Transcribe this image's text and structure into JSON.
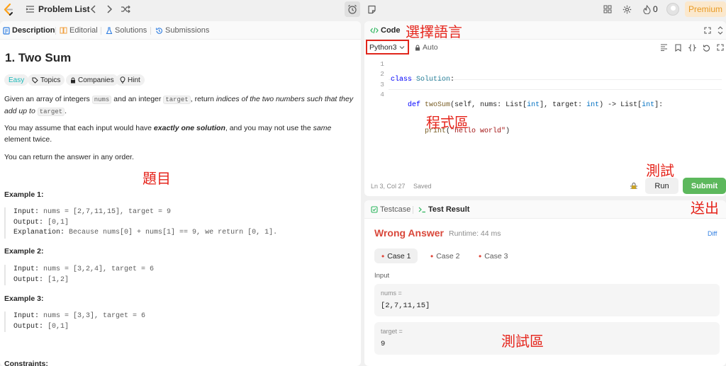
{
  "colors": {
    "accent_red": "#e5241b",
    "submit_green": "#5cb85c",
    "easy_teal": "#1cbaba",
    "premium_orange": "#e89b25",
    "wrong_answer": "#d9473a"
  },
  "topbar": {
    "problem_list": "Problem List",
    "streak_count": "0",
    "premium": "Premium",
    "icons": [
      "leetcode-logo",
      "list-icon",
      "chevron-left-icon",
      "chevron-right-icon",
      "shuffle-icon",
      "alarm-clock-icon",
      "note-icon",
      "layout-icon",
      "settings-icon",
      "flame-icon",
      "avatar"
    ]
  },
  "left_tabs": [
    {
      "label": "Description",
      "icon": "description-icon"
    },
    {
      "label": "Editorial",
      "icon": "editorial-icon"
    },
    {
      "label": "Solutions",
      "icon": "flask-icon"
    },
    {
      "label": "Submissions",
      "icon": "history-icon"
    }
  ],
  "problem": {
    "title": "1. Two Sum",
    "chips": {
      "difficulty": "Easy",
      "topics": "Topics",
      "companies": "Companies",
      "hint": "Hint"
    },
    "p1": {
      "a": "Given an array of integers ",
      "code1": "nums",
      "b": " and an integer ",
      "code2": "target",
      "c": ", return ",
      "em": "indices of the two numbers such that they add up to",
      "d": " ",
      "code3": "target",
      "e": "."
    },
    "p2": {
      "a": "You may assume that each input would have ",
      "strong": "exactly one solution",
      "b": ", and you may not use the ",
      "em": "same",
      "c": " element twice."
    },
    "p3": "You can return the answer in any order.",
    "examples": [
      {
        "title": "Example 1:",
        "input": "nums = [2,7,11,15], target = 9",
        "output": "[0,1]",
        "explanation": "Because nums[0] + nums[1] == 9, we return [0, 1]."
      },
      {
        "title": "Example 2:",
        "input": "nums = [3,2,4], target = 6",
        "output": "[1,2]"
      },
      {
        "title": "Example 3:",
        "input": "nums = [3,3], target = 6",
        "output": "[0,1]"
      }
    ],
    "labels": {
      "input": "Input:",
      "output": "Output:",
      "explanation": "Explanation:"
    },
    "constraints": "Constraints:"
  },
  "code_panel": {
    "tab": "Code",
    "language": "Python3",
    "auto": "Auto",
    "line_numbers": [
      "1",
      "2",
      "3",
      "4"
    ],
    "code": {
      "l1_kw": "class",
      "l1_cls": "Solution",
      "l1_end": ":",
      "l2_ind": "    ",
      "l2_kw": "def",
      "l2_fn": "twoSum",
      "l2_a": "(self, nums: List[",
      "l2_t1": "int",
      "l2_b": "], target: ",
      "l2_t2": "int",
      "l2_c": ") -> List[",
      "l2_t3": "int",
      "l2_d": "]:",
      "l3_ind": "        ",
      "l3_fn": "print",
      "l3_a": "(",
      "l3_str": "\"hello world\"",
      "l3_b": ")"
    },
    "cursor": "Ln 3, Col 27",
    "saved": "Saved",
    "run": "Run",
    "submit": "Submit"
  },
  "test_panel": {
    "tab_testcase": "Testcase",
    "tab_result": "Test Result",
    "verdict": "Wrong Answer",
    "runtime": "Runtime: 44 ms",
    "diff": "Diff",
    "cases": [
      "Case 1",
      "Case 2",
      "Case 3"
    ],
    "input_label": "Input",
    "vars": [
      {
        "name": "nums =",
        "value": "[2,7,11,15]"
      },
      {
        "name": "target =",
        "value": "9"
      }
    ]
  },
  "annotations": {
    "select_language": "選擇語言",
    "code_area": "程式區",
    "problem": "題目",
    "test": "測試",
    "submit": "送出",
    "test_area": "測試區"
  }
}
